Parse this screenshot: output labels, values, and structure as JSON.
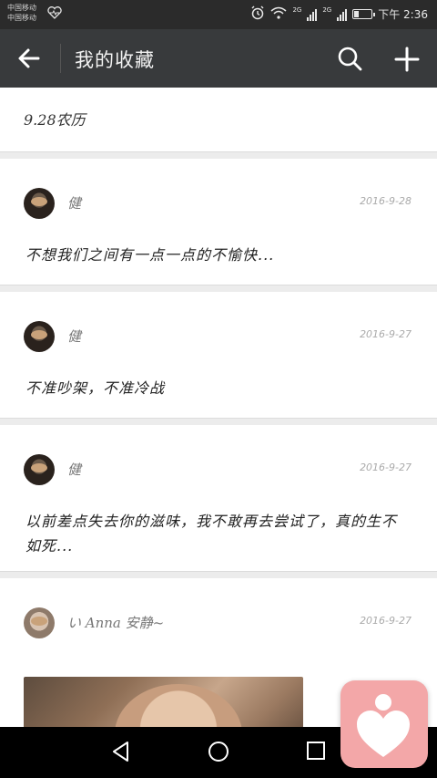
{
  "status_bar": {
    "carrier_1": "中国移动",
    "carrier_2": "中国移动",
    "net_1": "2G",
    "net_2": "2G",
    "time": "下午 2:36",
    "battery_level": 0.3
  },
  "app_bar": {
    "title": "我的收藏"
  },
  "date_header": "9.28农历",
  "posts": [
    {
      "username": "健",
      "date": "2016-9-28",
      "text": "不想我们之间有一点一点的不愉快..."
    },
    {
      "username": "健",
      "date": "2016-9-27",
      "text": "不准吵架，不准冷战"
    },
    {
      "username": "健",
      "date": "2016-9-27",
      "text": "以前差点失去你的滋味，我不敢再去尝试了，真的生不如死..."
    },
    {
      "username": "い Anna 安静~",
      "date": "2016-9-27",
      "text": ""
    }
  ],
  "icons": {
    "back": "arrow-left-icon",
    "search": "search-icon",
    "add": "plus-icon",
    "status_heart": "heart-rate-icon",
    "fab": "heart-person-icon"
  },
  "colors": {
    "app_bar": "#383a3c",
    "fab": "#f3a7a8"
  }
}
